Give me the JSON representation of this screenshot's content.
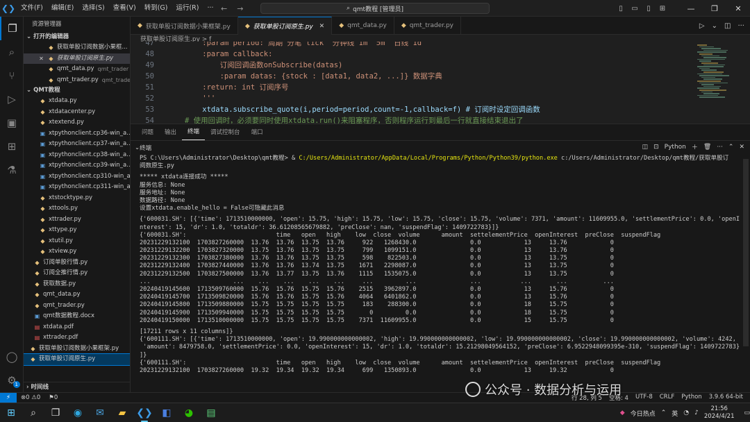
{
  "titlebar": {
    "menu": [
      "文件(F)",
      "编辑(E)",
      "选择(S)",
      "查看(V)",
      "转到(G)",
      "运行(R)",
      "···"
    ],
    "search": "qmt教程 [管理员]",
    "nav_back": "←",
    "nav_forward": "→"
  },
  "sidebar": {
    "title": "资源管理器",
    "open_editors_label": "打开的编辑器",
    "open_editors": [
      {
        "name": "获取单股订阅数据小果框...",
        "sub": ""
      },
      {
        "name": "获取单股订阅原生.py",
        "sub": ""
      },
      {
        "name": "qmt_data.py",
        "sub": "qmt_trader"
      },
      {
        "name": "qmt_trader.py",
        "sub": "qmt_trader"
      }
    ],
    "folder_label": "QMT教程",
    "files": [
      {
        "name": "xtdata.py",
        "type": "py",
        "indent": 1
      },
      {
        "name": "xtdatacenter.py",
        "type": "py",
        "indent": 1
      },
      {
        "name": "xtextend.py",
        "type": "py",
        "indent": 1
      },
      {
        "name": "xtpythonclient.cp36-win_a...",
        "type": "doc",
        "indent": 1
      },
      {
        "name": "xtpythonclient.cp37-win_a...",
        "type": "doc",
        "indent": 1
      },
      {
        "name": "xtpythonclient.cp38-win_a...",
        "type": "doc",
        "indent": 1
      },
      {
        "name": "xtpythonclient.cp39-win_a...",
        "type": "doc",
        "indent": 1
      },
      {
        "name": "xtpythonclient.cp310-win_a...",
        "type": "doc",
        "indent": 1
      },
      {
        "name": "xtpythonclient.cp311-win_a...",
        "type": "doc",
        "indent": 1
      },
      {
        "name": "xtstocktype.py",
        "type": "py",
        "indent": 1
      },
      {
        "name": "xttools.py",
        "type": "py",
        "indent": 1
      },
      {
        "name": "xttrader.py",
        "type": "py",
        "indent": 1
      },
      {
        "name": "xttype.py",
        "type": "py",
        "indent": 1
      },
      {
        "name": "xtutil.py",
        "type": "py",
        "indent": 1
      },
      {
        "name": "xtview.py",
        "type": "py",
        "indent": 1
      },
      {
        "name": "订阅单股行情.py",
        "type": "py",
        "indent": 0
      },
      {
        "name": "订阅全推行情.py",
        "type": "py",
        "indent": 0
      },
      {
        "name": "获取数据.py",
        "type": "py",
        "indent": 0
      },
      {
        "name": "qmt_data.py",
        "type": "py",
        "indent": 0
      },
      {
        "name": "qmt_trader.py",
        "type": "py",
        "indent": 0
      },
      {
        "name": "qmt数据教程.docx",
        "type": "doc",
        "indent": 0
      },
      {
        "name": "xtdata.pdf",
        "type": "pdf",
        "indent": 0
      },
      {
        "name": "xttrader.pdf",
        "type": "pdf",
        "indent": 0
      },
      {
        "name": "获取单股订阅数据小果框架.py",
        "type": "py",
        "indent": -1
      },
      {
        "name": "获取单股订阅原生.py",
        "type": "py",
        "indent": -1
      }
    ],
    "timeline_label": "时间线"
  },
  "tabs": [
    {
      "label": "获取单股订阅数据小果框架.py",
      "active": false
    },
    {
      "label": "获取单股订阅原生.py",
      "active": true
    },
    {
      "label": "qmt_data.py",
      "active": false
    },
    {
      "label": "qmt_trader.py",
      "active": false
    }
  ],
  "breadcrumb": "获取单股订阅原生.py > f",
  "editor": {
    "lines": [
      {
        "n": "47",
        "text": "    :param period: 周期 分笔\"tick\" 分钟线\"1m\" 5m\" 日线\"1d\"",
        "cls": "c-cmt"
      },
      {
        "n": "48",
        "text": "    :param callback:",
        "cls": "c-cmt"
      },
      {
        "n": "49",
        "text": "        订阅回调函数onSubscribe(datas)",
        "cls": "c-cmt"
      },
      {
        "n": "50",
        "text": "        :param datas: {stock : [data1, data2, ...]} 数据字典",
        "cls": "c-cmt"
      },
      {
        "n": "51",
        "text": "    :return: int 订阅序号",
        "cls": "c-cmt"
      },
      {
        "n": "52",
        "text": "    '''",
        "cls": "c-cmt"
      },
      {
        "n": "53",
        "text": "    xtdata.subscribe_quote(i,period=period,count=-1,callback=f) # 订阅时设定回调函数",
        "cls": "c-code"
      },
      {
        "n": "54",
        "text": "# 使用回调时，必须要同时使用xtdata.run()来阻塞程序，否则程序运行到最后一行就直接结束退出了",
        "cls": "c-green"
      }
    ]
  },
  "panel": {
    "tabs": [
      "问题",
      "输出",
      "终端",
      "调试控制台",
      "端口"
    ],
    "active_tab": "终端",
    "terminal_label": "终端",
    "shell": "Python",
    "lines": [
      "PS C:\\Users\\Administrator\\Desktop\\qmt教程> & C:/Users/Administrator/AppData/Local/Programs/Python/Python39/python.exe c:/Users/Administrator/Desktop/qmt教程/获取单股订",
      "阅数原生.py",
      "",
      "***** xtdata连接成功 *****",
      "服务信息: None",
      "服务地址: None",
      "数据路径: None",
      "设置xtdata.enable_hello = False可隐藏此消息",
      "",
      "{'600031.SH': [{'time': 1713510000000, 'open': 15.75, 'high': 15.75, 'low': 15.75, 'close': 15.75, 'volume': 7371, 'amount': 11609955.0, 'settlementPrice': 0.0, 'openI",
      "nterest': 15, 'dr': 1.0, 'totaldr': 36.61208565679882, 'preClose': nan, 'suspendFlag': 1409722783}]}",
      "{'600031.SH':                         time   open   high    low  close  volume      amount  settelementPrice  openInterest  preClose  suspendFlag",
      "20231229132100  1703827260000  13.76  13.76  13.75  13.76     922   1268430.0               0.0            13     13.76            0",
      "20231229132200  1703827320000  13.75  13.76  13.75  13.75     799   1099151.0               0.0            13     13.76            0",
      "20231229132300  1703827380000  13.76  13.76  13.75  13.75     598    822503.0               0.0            13     13.75            0",
      "20231229132400  1703827440000  13.76  13.76  13.74  13.75    1671   2298087.0               0.0            13     13.75            0",
      "20231229132500  1703827500000  13.76  13.77  13.75  13.76    1115   1535075.0               0.0            13     13.75            0",
      "...                       ...    ...    ...    ...    ...     ...         ...               ...           ...       ...          ...",
      "20240419145600  1713509760000  15.76  15.76  15.75  15.76    2515   3962897.0               0.0            13     15.76            0",
      "20240419145700  1713509820000  15.76  15.76  15.75  15.76    4064   6401862.0               0.0            13     15.76            0",
      "20240419145800  1713509880000  15.75  15.75  15.75  15.75     183    288300.0               0.0            18     15.75            0",
      "20240419145900  1713509940000  15.75  15.75  15.75  15.75       0         0.0               0.0            18     15.75            0",
      "20240419150000  1713510000000  15.75  15.75  15.75  15.75    7371  11609955.0               0.0            15     15.75            0",
      "",
      "[17211 rows x 11 columns]}",
      "{'600111.SH': [{'time': 1713510000000, 'open': 19.990000000000002, 'high': 19.990000000000002, 'low': 19.990000000000002, 'close': 19.990000000000002, 'volume': 4242,",
      " 'amount': 8479758.0, 'settlementPrice': 0.0, 'openInterest': 15, 'dr': 1.0, 'totaldr': 15.21298049564152, 'preClose': 6.9522948099395e-310, 'suspendFlag': 1409722783}",
      "]}",
      "{'600111.SH':                         time   open   high    low  close  volume      amount  settelementPrice  openInterest  preClose  suspendFlag",
      "20231229132100  1703827260000  19.32  19.34  19.32  19.34     699   1350893.0               0.0            13     19.32            0"
    ]
  },
  "statusbar": {
    "remote": "⚡",
    "problems": "⊗0 ⚠0",
    "ports": "⚑0",
    "right": [
      "行 28, 列 5",
      "空格: 4",
      "UTF-8",
      "CRLF",
      "Python",
      "3.9.6 64-bit"
    ]
  },
  "taskbar": {
    "weather": "今日热点",
    "lang": "英",
    "time": "21:56",
    "date": "2024/4/21"
  },
  "watermark": "公众号 · 数据分析与运用"
}
